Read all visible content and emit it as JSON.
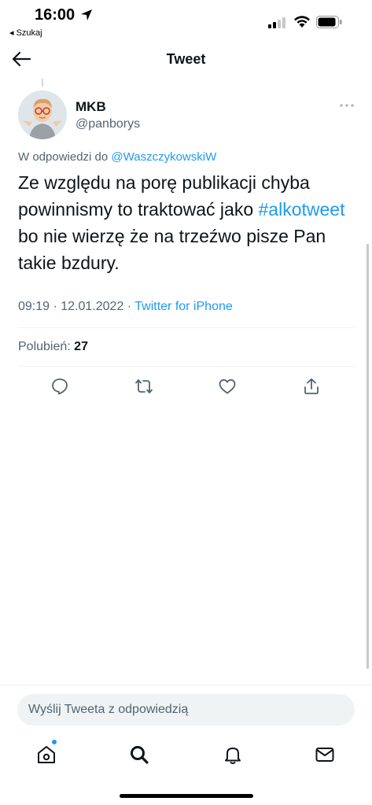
{
  "status": {
    "time": "16:00",
    "back_app": "◂ Szukaj"
  },
  "header": {
    "title": "Tweet"
  },
  "tweet": {
    "author_name": "MKB",
    "author_handle": "@panborys",
    "reply_prefix": "W odpowiedzi do ",
    "reply_mention": "@WaszczykowskiW",
    "text_before": "Ze względu na porę publikacji chyba powinnismy to traktować jako ",
    "hashtag": "#alkotweet",
    "text_after": " bo nie wierzę że na trzeźwo pisze Pan takie bzdury.",
    "timestamp": "09:19 · 12.01.2022 · ",
    "source": "Twitter for iPhone",
    "likes_label": "Polubień: ",
    "likes_count": "27"
  },
  "reply": {
    "placeholder": "Wyślij Tweeta z odpowiedzią"
  },
  "icons": {
    "actions": [
      "reply-icon",
      "retweet-icon",
      "like-icon",
      "share-icon"
    ],
    "tabs": [
      "home-icon",
      "search-icon",
      "notifications-icon",
      "messages-icon"
    ]
  },
  "colors": {
    "accent": "#1d9bf0",
    "text": "#0f1419",
    "secondary": "#536471"
  }
}
